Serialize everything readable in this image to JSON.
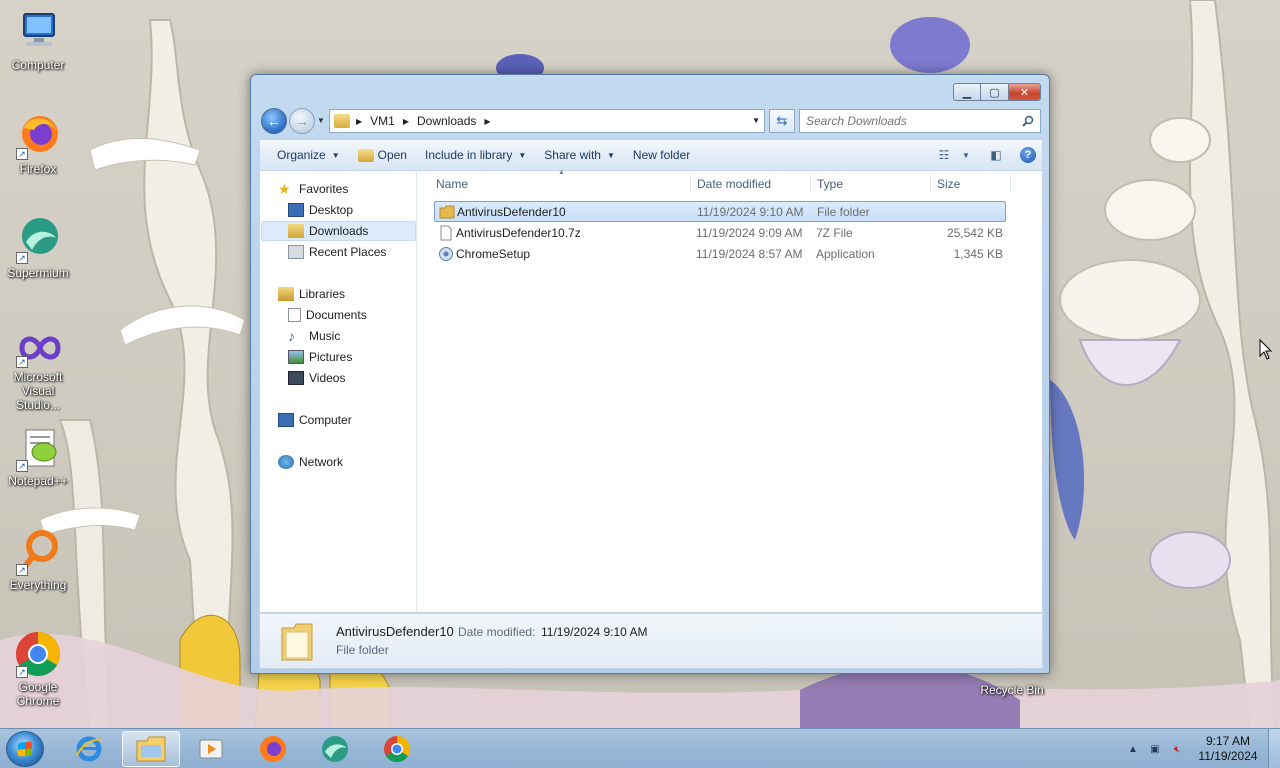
{
  "desktop": {
    "icons": [
      {
        "label": "Computer"
      },
      {
        "label": "Firefox"
      },
      {
        "label": "Supermium"
      },
      {
        "label": "Microsoft Visual Studio..."
      },
      {
        "label": "Notepad++"
      },
      {
        "label": "Everything"
      },
      {
        "label": "Google Chrome"
      }
    ],
    "recycle_bin": "Recycle Bin"
  },
  "window": {
    "breadcrumb": [
      "VM1",
      "Downloads"
    ],
    "search_placeholder": "Search Downloads",
    "toolbar": {
      "organize": "Organize",
      "open": "Open",
      "include_in_library": "Include in library",
      "share_with": "Share with",
      "new_folder": "New folder"
    },
    "nav": {
      "favorites": "Favorites",
      "desktop": "Desktop",
      "downloads": "Downloads",
      "recent_places": "Recent Places",
      "libraries": "Libraries",
      "documents": "Documents",
      "music": "Music",
      "pictures": "Pictures",
      "videos": "Videos",
      "computer": "Computer",
      "network": "Network"
    },
    "columns": {
      "name": "Name",
      "date_modified": "Date modified",
      "type": "Type",
      "size": "Size"
    },
    "files": [
      {
        "name": "AntivirusDefender10",
        "date": "11/19/2024 9:10 AM",
        "type": "File folder",
        "size": "",
        "icon": "folder-icon"
      },
      {
        "name": "AntivirusDefender10.7z",
        "date": "11/19/2024 9:09 AM",
        "type": "7Z File",
        "size": "25,542 KB",
        "icon": "archive-file-icon"
      },
      {
        "name": "ChromeSetup",
        "date": "11/19/2024 8:57 AM",
        "type": "Application",
        "size": "1,345 KB",
        "icon": "installer-icon"
      }
    ],
    "details": {
      "name": "AntivirusDefender10",
      "date_label": "Date modified:",
      "date_value": "11/19/2024 9:10 AM",
      "type": "File folder"
    }
  },
  "taskbar": {
    "time": "9:17 AM",
    "date": "11/19/2024"
  }
}
